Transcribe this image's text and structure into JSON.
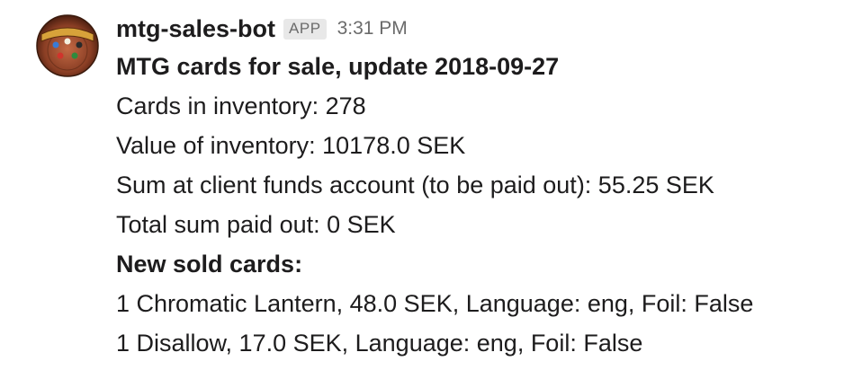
{
  "message": {
    "bot_name": "mtg-sales-bot",
    "badge": "APP",
    "time": "3:31 PM",
    "avatar_icon": "magic-the-gathering-logo-icon",
    "title": "MTG cards for sale, update 2018-09-27",
    "lines": [
      "Cards in inventory: 278",
      "Value of inventory: 10178.0 SEK",
      "Sum at client funds account (to be paid out): 55.25 SEK",
      "Total sum paid out: 0 SEK"
    ],
    "sold_heading": "New sold cards:",
    "sold_items": [
      "1 Chromatic Lantern, 48.0 SEK, Language: eng, Foil: False",
      "1 Disallow, 17.0 SEK, Language: eng, Foil: False"
    ]
  }
}
